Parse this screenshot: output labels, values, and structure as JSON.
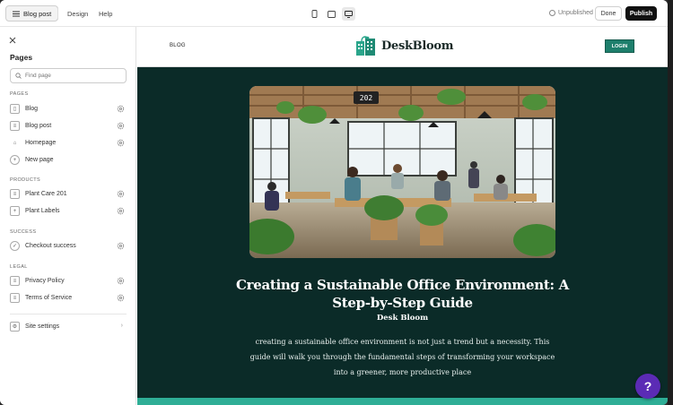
{
  "topbar": {
    "page_selector": "Blog post",
    "design": "Design",
    "help": "Help",
    "status": "Unpublished",
    "done": "Done",
    "publish": "Publish"
  },
  "sidebar": {
    "title": "Pages",
    "search_placeholder": "Find page",
    "sections": {
      "pages": "PAGES",
      "products": "PRODUCTS",
      "success": "SUCCESS",
      "legal": "LEGAL"
    },
    "pages": [
      "Blog",
      "Blog post",
      "Homepage"
    ],
    "new_page": "New page",
    "products": [
      "Plant Care 201",
      "Plant Labels"
    ],
    "success": [
      "Checkout success"
    ],
    "legal": [
      "Privacy Policy",
      "Terms of Service"
    ],
    "site_settings": "Site settings"
  },
  "site": {
    "nav_blog": "BLOG",
    "logo": "DeskBloom",
    "login": "LOGIN",
    "post_title": "Creating a Sustainable Office Environment: A Step-by-Step Guide",
    "author": "Desk Bloom",
    "intro": "creating a sustainable office environment is not just a trend but a necessity. This guide will walk you through the fundamental steps of transforming your workspace into a greener, more productive place",
    "hero_clock": "202"
  },
  "colors": {
    "canvas_bg": "#0b2b28",
    "brand": "#1e7f6c",
    "accent_strip": "#2fae96",
    "publish": "#111111",
    "help_fab": "#5b2bb5"
  }
}
